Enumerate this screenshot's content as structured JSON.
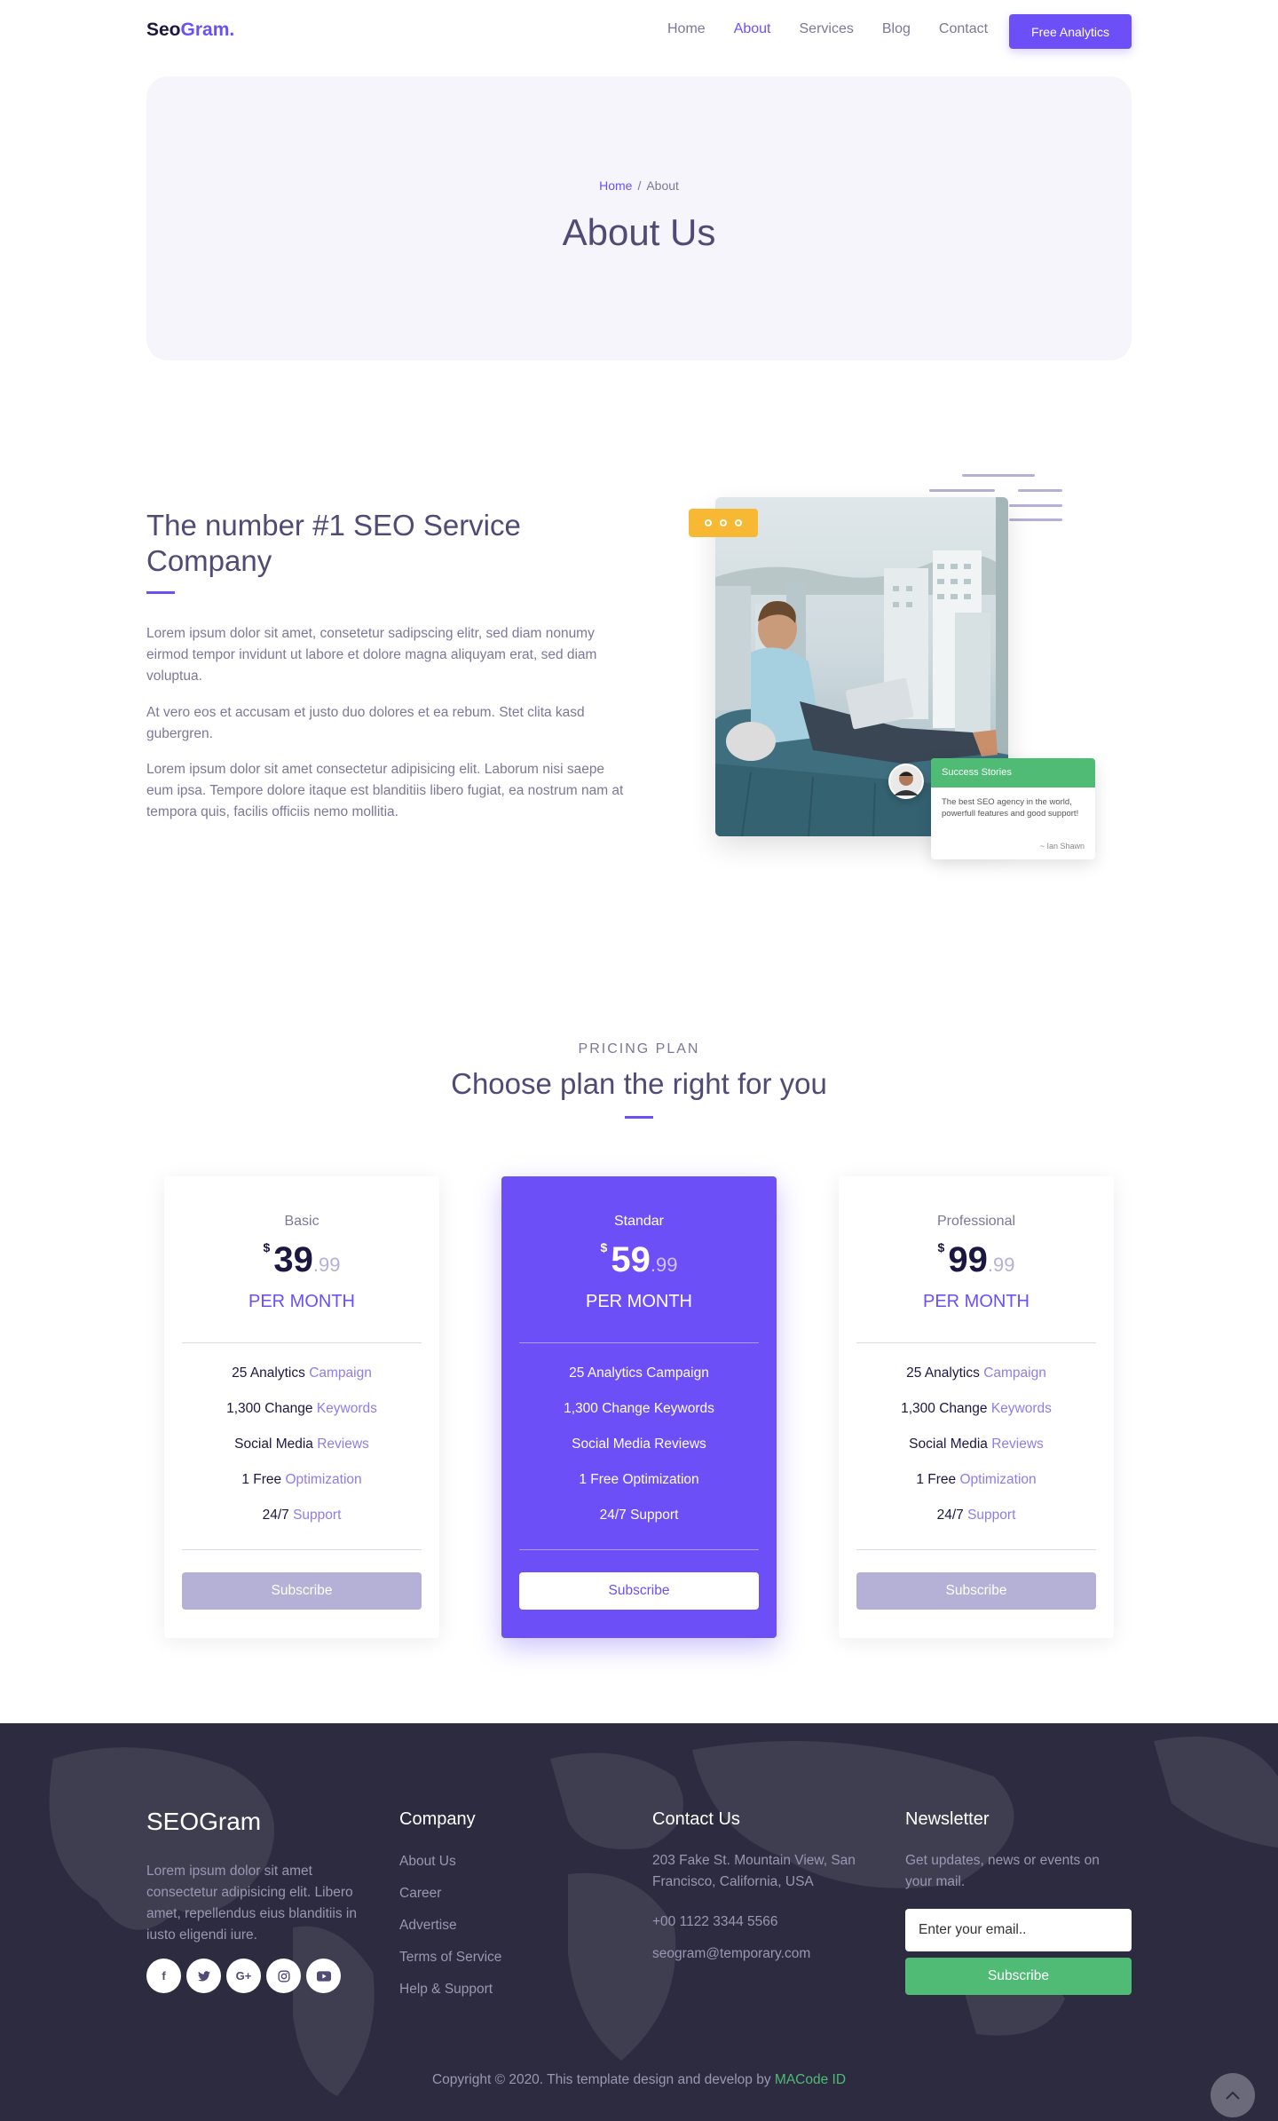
{
  "nav": {
    "logo_main": "Seo",
    "logo_accent": "Gram.",
    "links": [
      "Home",
      "About",
      "Services",
      "Blog",
      "Contact"
    ],
    "active": "About",
    "cta": "Free Analytics"
  },
  "hero": {
    "breadcrumb_home": "Home",
    "breadcrumb_sep": "/",
    "breadcrumb_current": "About",
    "title": "About Us"
  },
  "about": {
    "title": "The number #1 SEO Service Company",
    "paragraphs": [
      "Lorem ipsum dolor sit amet, consetetur sadipscing elitr, sed diam nonumy eirmod tempor invidunt ut labore et dolore magna aliquyam erat, sed diam voluptua.",
      "At vero eos et accusam et justo duo dolores et ea rebum. Stet clita kasd gubergren.",
      "Lorem ipsum dolor sit amet consectetur adipisicing elit. Laborum nisi saepe eum ipsa. Tempore dolore itaque est blanditiis libero fugiat, ea nostrum nam at tempora quis, facilis officiis nemo mollitia."
    ],
    "story": {
      "title": "Success Stories",
      "text": "The best SEO agency in the world, powerfull features and good support!",
      "author": "~ Ian Shawn"
    }
  },
  "pricing": {
    "eyebrow": "PRICING PLAN",
    "title": "Choose plan the right for you",
    "plans": [
      {
        "name": "Basic",
        "currency": "$",
        "amount": "39",
        "cents": ".99",
        "period": "PER MONTH",
        "features": [
          {
            "strong": "25 Analytics",
            "soft": "Campaign"
          },
          {
            "strong": "1,300 Change",
            "soft": "Keywords"
          },
          {
            "strong": "Social Media",
            "soft": "Reviews"
          },
          {
            "strong": "1 Free",
            "soft": "Optimization"
          },
          {
            "strong": "24/7",
            "soft": "Support"
          }
        ],
        "button": "Subscribe",
        "featured": false
      },
      {
        "name": "Standar",
        "currency": "$",
        "amount": "59",
        "cents": ".99",
        "period": "PER MONTH",
        "features": [
          {
            "strong": "25 Analytics",
            "soft": "Campaign"
          },
          {
            "strong": "1,300 Change",
            "soft": "Keywords"
          },
          {
            "strong": "Social Media",
            "soft": "Reviews"
          },
          {
            "strong": "1 Free",
            "soft": "Optimization"
          },
          {
            "strong": "24/7",
            "soft": "Support"
          }
        ],
        "button": "Subscribe",
        "featured": true
      },
      {
        "name": "Professional",
        "currency": "$",
        "amount": "99",
        "cents": ".99",
        "period": "PER MONTH",
        "features": [
          {
            "strong": "25 Analytics",
            "soft": "Campaign"
          },
          {
            "strong": "1,300 Change",
            "soft": "Keywords"
          },
          {
            "strong": "Social Media",
            "soft": "Reviews"
          },
          {
            "strong": "1 Free",
            "soft": "Optimization"
          },
          {
            "strong": "24/7",
            "soft": "Support"
          }
        ],
        "button": "Subscribe",
        "featured": false
      }
    ]
  },
  "footer": {
    "logo": "SEOGram",
    "about": "Lorem ipsum dolor sit amet consectetur adipisicing elit. Libero amet, repellendus eius blanditiis in iusto eligendi iure.",
    "socials": [
      {
        "icon": "facebook-icon",
        "glyph": "f"
      },
      {
        "icon": "twitter-icon",
        "glyph": "t"
      },
      {
        "icon": "google-plus-icon",
        "glyph": "G+"
      },
      {
        "icon": "instagram-icon",
        "glyph": "◎"
      },
      {
        "icon": "youtube-icon",
        "glyph": "▶"
      }
    ],
    "company": {
      "title": "Company",
      "links": [
        "About Us",
        "Career",
        "Advertise",
        "Terms of Service",
        "Help & Support"
      ]
    },
    "contact": {
      "title": "Contact Us",
      "address": "203 Fake St. Mountain View, San Francisco, California, USA",
      "phone": "+00 1122 3344 5566",
      "email": "seogram@temporary.com"
    },
    "newsletter": {
      "title": "Newsletter",
      "text": "Get updates, news or events on your mail.",
      "placeholder": "Enter your email..",
      "button": "Subscribe"
    },
    "copyright_text": "Copyright © 2020. This template design and develop by",
    "copyright_brand": "MACode ID"
  },
  "colors": {
    "accent": "#6c4ff7",
    "green": "#4fbb75",
    "yellow": "#f7b833",
    "footer_bg": "#2c2b3f"
  }
}
